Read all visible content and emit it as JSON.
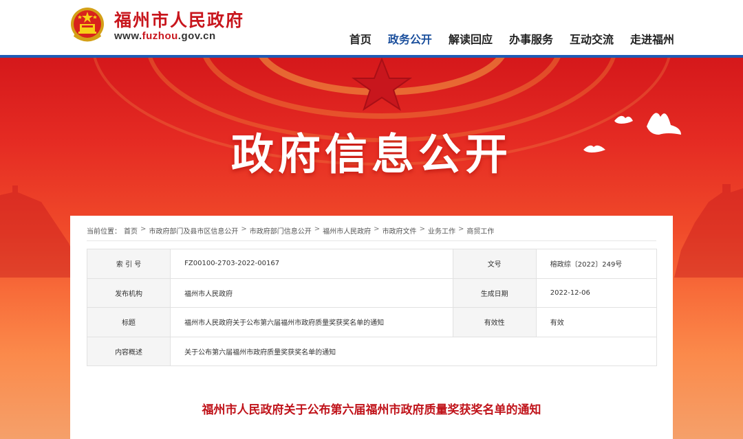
{
  "header": {
    "site_name": "福州市人民政府",
    "site_url_prefix": "www.",
    "site_url_highlight": "fuzhou",
    "site_url_suffix": ".gov.cn",
    "emblem_icon": "national-emblem-icon",
    "nav": [
      {
        "label": "首页",
        "active": false
      },
      {
        "label": "政务公开",
        "active": true
      },
      {
        "label": "解读回应",
        "active": false
      },
      {
        "label": "办事服务",
        "active": false
      },
      {
        "label": "互动交流",
        "active": false
      },
      {
        "label": "走进福州",
        "active": false
      }
    ]
  },
  "banner": {
    "title": "政府信息公开",
    "decor_icons": [
      "star-icon",
      "dove-icon",
      "great-wall-icon"
    ]
  },
  "breadcrumb": {
    "prefix": "当前位置：",
    "items": [
      "首页",
      "市政府部门及县市区信息公开",
      "市政府部门信息公开",
      "福州市人民政府",
      "市政府文件",
      "业务工作",
      "商贸工作"
    ],
    "separator": ">"
  },
  "info": {
    "rows": [
      {
        "k1": "索 引 号",
        "v1": "FZ00100-2703-2022-00167",
        "k2": "文号",
        "v2": "榕政综〔2022〕249号"
      },
      {
        "k1": "发布机构",
        "v1": "福州市人民政府",
        "k2": "生成日期",
        "v2": "2022-12-06"
      },
      {
        "k1": "标题",
        "v1": "福州市人民政府关于公布第六届福州市政府质量奖获奖名单的通知",
        "k2": "有效性",
        "v2": "有效"
      },
      {
        "k1": "内容概述",
        "v1": "关于公布第六届福州市政府质量奖获奖名单的通知"
      }
    ]
  },
  "document": {
    "title": "福州市人民政府关于公布第六届福州市政府质量奖获奖名单的通知"
  },
  "colors": {
    "brand_red": "#c8161d",
    "nav_active": "#1b4f9c",
    "header_line": "#1f5bb5",
    "doc_title": "#c0141b"
  }
}
